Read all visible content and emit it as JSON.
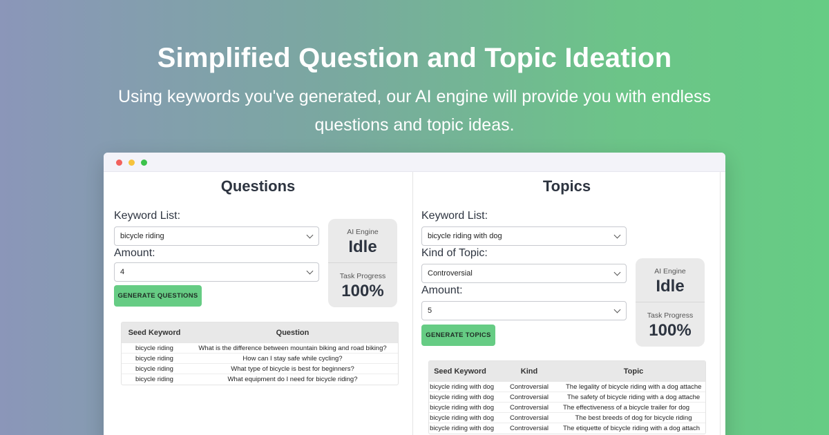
{
  "hero": {
    "title": "Simplified Question and Topic Ideation",
    "subtitle": "Using keywords you've generated, our AI engine will provide you with endless questions and topic ideas."
  },
  "questions": {
    "title": "Questions",
    "keyword_label": "Keyword List:",
    "keyword_value": "bicycle riding",
    "amount_label": "Amount:",
    "amount_value": "4",
    "button": "GENERATE QUESTIONS",
    "engine_label": "AI Engine",
    "engine_value": "Idle",
    "progress_label": "Task Progress",
    "progress_value": "100%",
    "columns": [
      "Seed Keyword",
      "Question"
    ],
    "rows": [
      [
        "bicycle riding",
        "What is the difference between mountain biking and road biking?"
      ],
      [
        "bicycle riding",
        "How can I stay safe while cycling?"
      ],
      [
        "bicycle riding",
        "What type of bicycle is best for beginners?"
      ],
      [
        "bicycle riding",
        "What equipment do I need for bicycle riding?"
      ]
    ]
  },
  "topics": {
    "title": "Topics",
    "keyword_label": "Keyword List:",
    "keyword_value": "bicycle riding with dog",
    "kind_label": "Kind of Topic:",
    "kind_value": "Controversial",
    "amount_label": "Amount:",
    "amount_value": "5",
    "button": "GENERATE TOPICS",
    "engine_label": "AI Engine",
    "engine_value": "Idle",
    "progress_label": "Task Progress",
    "progress_value": "100%",
    "columns": [
      "Seed Keyword",
      "Kind",
      "Topic"
    ],
    "rows": [
      [
        "bicycle riding with dog",
        "Controversial",
        "The legality of bicycle riding with a dog attache"
      ],
      [
        "bicycle riding with dog",
        "Controversial",
        "The safety of bicycle riding with a dog attache"
      ],
      [
        "bicycle riding with dog",
        "Controversial",
        "The effectiveness of a bicycle trailer for dog"
      ],
      [
        "bicycle riding with dog",
        "Controversial",
        "The best breeds of dog for bicycle riding"
      ],
      [
        "bicycle riding with dog",
        "Controversial",
        "The etiquette of bicycle riding with a dog attach"
      ]
    ]
  },
  "colors": {
    "accent_green": "#66cc84",
    "status_bg": "#eaeaea"
  }
}
